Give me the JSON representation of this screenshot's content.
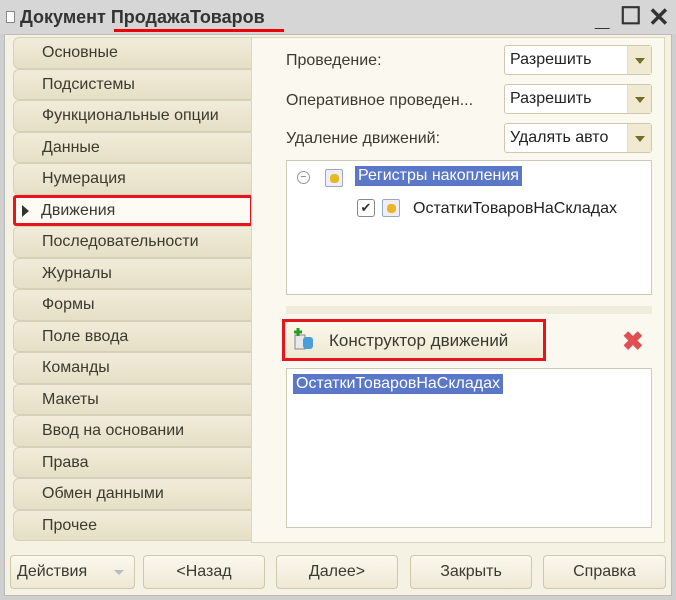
{
  "window": {
    "title": "Документ ПродажаТоваров"
  },
  "sidebar": {
    "items": [
      {
        "label": "Основные"
      },
      {
        "label": "Подсистемы"
      },
      {
        "label": "Функциональные опции"
      },
      {
        "label": "Данные"
      },
      {
        "label": "Нумерация"
      },
      {
        "label": "Движения",
        "active": true
      },
      {
        "label": "Последовательности"
      },
      {
        "label": "Журналы"
      },
      {
        "label": "Формы"
      },
      {
        "label": "Поле ввода"
      },
      {
        "label": "Команды"
      },
      {
        "label": "Макеты"
      },
      {
        "label": "Ввод на основании"
      },
      {
        "label": "Права"
      },
      {
        "label": "Обмен данными"
      },
      {
        "label": "Прочее"
      }
    ]
  },
  "main": {
    "posting_label": "Проведение:",
    "posting_value": "Разрешить",
    "realtime_label": "Оперативное проведен...",
    "realtime_value": "Разрешить",
    "delete_label": "Удаление движений:",
    "delete_value": "Удалять авто",
    "tree": {
      "root": "Регистры накопления",
      "child": "ОстаткиТоваровНаСкладах"
    },
    "constructor_label": "Конструктор движений",
    "list_item": "ОстаткиТоваровНаСкладах"
  },
  "footer": {
    "actions": "Действия",
    "back": "<Назад",
    "next": "Далее>",
    "close": "Закрыть",
    "help": "Справка"
  },
  "colors": {
    "accent_red": "#e8141b",
    "selection": "#5b78c8"
  }
}
